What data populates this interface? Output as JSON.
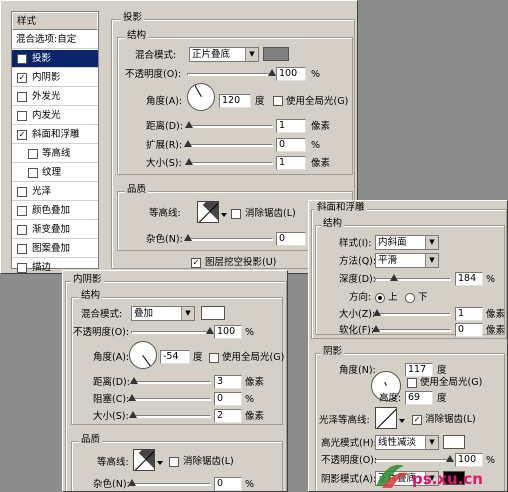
{
  "sidebar": {
    "title": "样式",
    "items": [
      {
        "label": "混合选项:自定",
        "check": null,
        "sub": false,
        "active": false
      },
      {
        "label": "投影",
        "check": true,
        "sub": false,
        "active": true
      },
      {
        "label": "内阴影",
        "check": true,
        "sub": false,
        "active": false
      },
      {
        "label": "外发光",
        "check": false,
        "sub": false,
        "active": false
      },
      {
        "label": "内发光",
        "check": false,
        "sub": false,
        "active": false
      },
      {
        "label": "斜面和浮雕",
        "check": true,
        "sub": false,
        "active": false
      },
      {
        "label": "等高线",
        "check": false,
        "sub": true,
        "active": false
      },
      {
        "label": "纹理",
        "check": false,
        "sub": true,
        "active": false
      },
      {
        "label": "光泽",
        "check": false,
        "sub": false,
        "active": false
      },
      {
        "label": "颜色叠加",
        "check": false,
        "sub": false,
        "active": false
      },
      {
        "label": "渐变叠加",
        "check": false,
        "sub": false,
        "active": false
      },
      {
        "label": "图案叠加",
        "check": false,
        "sub": false,
        "active": false
      },
      {
        "label": "描边",
        "check": false,
        "sub": false,
        "active": false
      }
    ]
  },
  "drop_shadow": {
    "title": "投影",
    "structure": "结构",
    "blend_label": "混合模式:",
    "blend_value": "正片叠底",
    "blend_color": "#808080",
    "opacity_label": "不透明度(O):",
    "opacity": "100",
    "opacity_fraction": 1.0,
    "pct": "%",
    "angle_label": "角度(A):",
    "angle": "120",
    "deg": "度",
    "global_label": "使用全局光(G)",
    "distance_label": "距离(D):",
    "distance": "1",
    "px": "像素",
    "spread_label": "扩展(R):",
    "spread": "0",
    "size_label": "大小(S):",
    "size": "1",
    "quality": "品质",
    "contour_label": "等高线:",
    "antialias_label": "消除锯齿(L)",
    "noise_label": "杂色(N):",
    "noise": "0",
    "knockout_label": "图层挖空投影(U)"
  },
  "inner_shadow": {
    "title": "内阴影",
    "structure": "结构",
    "blend_label": "混合模式:",
    "blend_value": "叠加",
    "blend_color": "#ffffff",
    "opacity_label": "不透明度(O):",
    "opacity": "100",
    "opacity_fraction": 1.0,
    "pct": "%",
    "angle_label": "角度(A):",
    "angle": "-54",
    "deg": "度",
    "global_label": "使用全局光(G)",
    "distance_label": "距离(D):",
    "distance": "3",
    "px": "像素",
    "choke_label": "阻塞(C):",
    "choke": "0",
    "size_label": "大小(S):",
    "size": "2",
    "quality": "品质",
    "contour_label": "等高线:",
    "antialias_label": "消除锯齿(L)",
    "noise_label": "杂色(N):",
    "noise": "0"
  },
  "bevel": {
    "title": "斜面和浮雕",
    "structure": "结构",
    "style_label": "样式(I):",
    "style_value": "内斜面",
    "technique_label": "方法(Q):",
    "technique_value": "平滑",
    "depth_label": "深度(D):",
    "depth": "184",
    "pct": "%",
    "direction_label": "方向:",
    "up_label": "上",
    "down_label": "下",
    "size_label": "大小(Z):",
    "size": "1",
    "px": "像素",
    "soften_label": "软化(F):",
    "soften": "0",
    "shading": "阴影",
    "angle_label": "角度(N):",
    "angle": "117",
    "deg": "度",
    "global_label": "使用全局光(G)",
    "altitude_label": "高度:",
    "altitude": "69",
    "gloss_label": "光泽等高线:",
    "antialias_label": "消除锯齿(L)",
    "highlight_label": "高光模式(H):",
    "highlight_value": "线性减淡",
    "hl_opacity_label": "不透明度(O):",
    "hl_opacity": "100",
    "shadow_label": "阴影模式(A):",
    "shadow_value": "正片叠底"
  },
  "watermark": {
    "text": "ps.xu.cn"
  }
}
